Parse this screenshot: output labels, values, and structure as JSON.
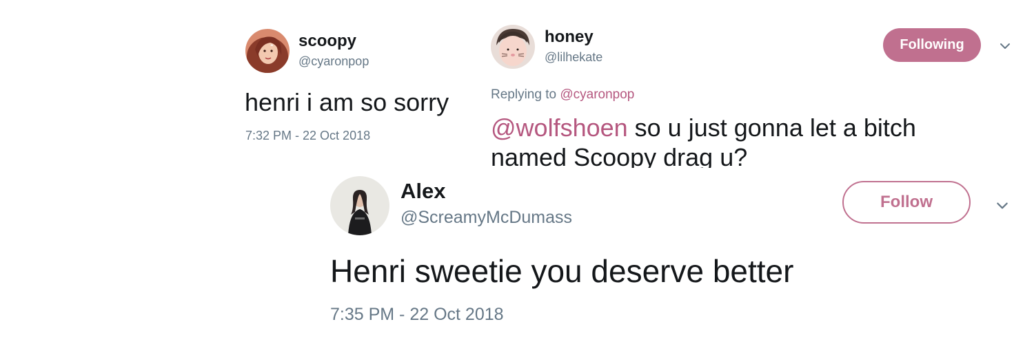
{
  "colors": {
    "accent": "#c0708f",
    "mention": "#b5577f",
    "secondary_text": "#657786",
    "primary_text": "#14171a"
  },
  "tweets": [
    {
      "avatar_icon": "user-avatar-photo",
      "name": "scoopy",
      "handle": "@cyaronpop",
      "text": "henri i am so sorry",
      "timestamp": "7:32 PM - 22 Oct 2018"
    },
    {
      "avatar_icon": "user-avatar-photo",
      "name": "honey",
      "handle": "@lilhekate",
      "follow_label": "Following",
      "menu_icon": "chevron-down-icon",
      "replying_prefix": "Replying to ",
      "replying_to": "@cyaronpop",
      "mention": "@wolfshoen",
      "text": " so u just gonna let a bitch named Scoopy drag u?"
    },
    {
      "avatar_icon": "user-avatar-photo",
      "name": "Alex",
      "handle": "@ScreamyMcDumass",
      "follow_label": "Follow",
      "menu_icon": "chevron-down-icon",
      "text": "Henri sweetie you deserve better",
      "timestamp": "7:35 PM - 22 Oct 2018"
    }
  ]
}
